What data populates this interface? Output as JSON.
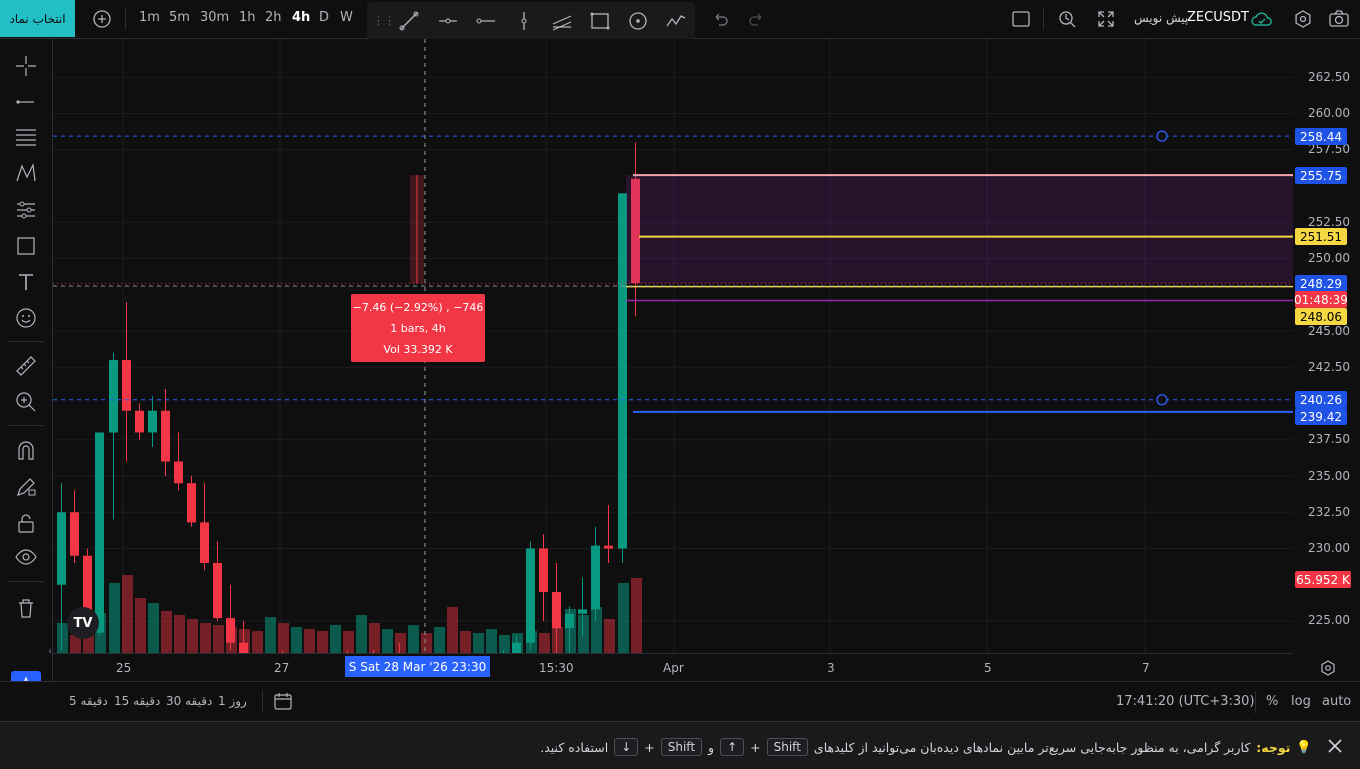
{
  "topbar": {
    "symbol_button": "انتخاب نماد",
    "timeframes": [
      "1m",
      "5m",
      "30m",
      "1h",
      "2h",
      "4h",
      "D",
      "W"
    ],
    "active_timeframe": "4h",
    "symbol": "ZECUSDT",
    "predict_label": "پیش نویس"
  },
  "price_axis": {
    "labels": [
      "262.50",
      "260.00",
      "257.50",
      "252.50",
      "250.00",
      "245.00",
      "242.50",
      "237.50",
      "235.00",
      "232.50",
      "230.00",
      "225.00"
    ],
    "tags": [
      {
        "text": "258.44",
        "bg": "#1e53e5",
        "fg": "#ffffff"
      },
      {
        "text": "255.75",
        "bg": "#1e53e5",
        "fg": "#ffffff"
      },
      {
        "text": "251.51",
        "bg": "#f5d742",
        "fg": "#000000"
      },
      {
        "text": "248.29",
        "bg": "#1e53e5",
        "fg": "#ffffff"
      },
      {
        "text": "01:48:39",
        "bg": "#f23645",
        "fg": "#ffffff"
      },
      {
        "text": "248.06",
        "bg": "#f5d742",
        "fg": "#000000"
      },
      {
        "text": "240.26",
        "bg": "#1e53e5",
        "fg": "#ffffff"
      },
      {
        "text": "239.42",
        "bg": "#1e53e5",
        "fg": "#ffffff"
      },
      {
        "text": "65.952 K",
        "bg": "#f23645",
        "fg": "#ffffff"
      }
    ]
  },
  "time_axis": {
    "labels": [
      "25",
      "27",
      "15:30",
      "Apr",
      "3",
      "5",
      "7"
    ],
    "crosshair_label": "S  Sat 28 Mar '26   23:30"
  },
  "measure": {
    "line1": "−7.46 (−2.92%) , −746",
    "line2": "1 bars, 4h",
    "line3": "Vol 33.392 K"
  },
  "bottombar": {
    "ranges": [
      "5 دقیقه",
      "15 دقیقه",
      "30 دقیقه",
      "1 روز"
    ],
    "clock": "17:41:20 (UTC+3:30)",
    "pct": "%",
    "log": "log",
    "auto": "auto"
  },
  "notice": {
    "label": "توجه:",
    "text1": "کاربر گرامی، به منظور جابه‌جایی سریع‌تر مابین نمادهای دیده‌بان می‌توانید از کلیدهای",
    "key_shift": "Shift",
    "key_up": "↑",
    "and": "و",
    "key_down": "↓",
    "text2": "استفاده کنید."
  },
  "colors": {
    "up": "#089981",
    "down": "#f23645",
    "accent": "#22c0c5",
    "blue": "#2962ff",
    "yellow": "#f5d742",
    "purple": "#9c27b0"
  }
}
